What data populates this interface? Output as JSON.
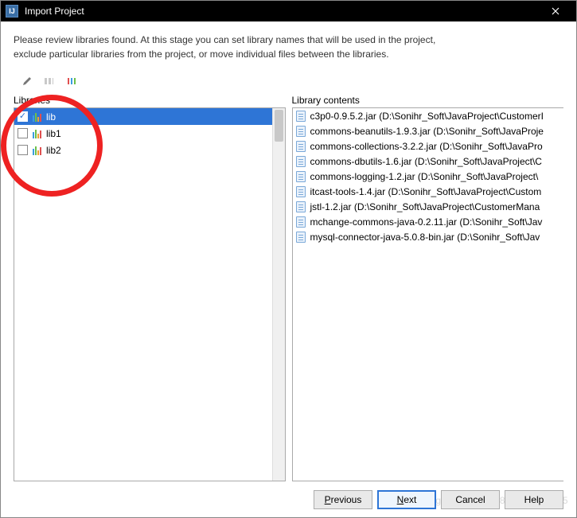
{
  "window": {
    "title": "Import Project"
  },
  "description": {
    "line1": "Please review libraries found. At this stage you can set library names that will be used in the project,",
    "line2": "exclude particular libraries from the project, or move individual files between the libraries."
  },
  "panels": {
    "libraries_label": "Libraries",
    "contents_label": "Library contents"
  },
  "libraries": [
    {
      "name": "lib",
      "checked": true,
      "selected": true
    },
    {
      "name": "lib1",
      "checked": false,
      "selected": false
    },
    {
      "name": "lib2",
      "checked": false,
      "selected": false
    }
  ],
  "library_contents": [
    "c3p0-0.9.5.2.jar (D:\\Sonihr_Soft\\JavaProject\\CustomerI",
    "commons-beanutils-1.9.3.jar (D:\\Sonihr_Soft\\JavaProje",
    "commons-collections-3.2.2.jar (D:\\Sonihr_Soft\\JavaPro",
    "commons-dbutils-1.6.jar (D:\\Sonihr_Soft\\JavaProject\\C",
    "commons-logging-1.2.jar (D:\\Sonihr_Soft\\JavaProject\\",
    "itcast-tools-1.4.jar (D:\\Sonihr_Soft\\JavaProject\\Custom",
    "jstl-1.2.jar (D:\\Sonihr_Soft\\JavaProject\\CustomerMana",
    "mchange-commons-java-0.2.11.jar (D:\\Sonihr_Soft\\Jav",
    "mysql-connector-java-5.0.8-bin.jar (D:\\Sonihr_Soft\\Jav"
  ],
  "buttons": {
    "previous": "Previous",
    "next": "Next",
    "cancel": "Cancel",
    "help": "Help"
  },
  "watermark": "https://blog.csdn.net/wa826497052015"
}
